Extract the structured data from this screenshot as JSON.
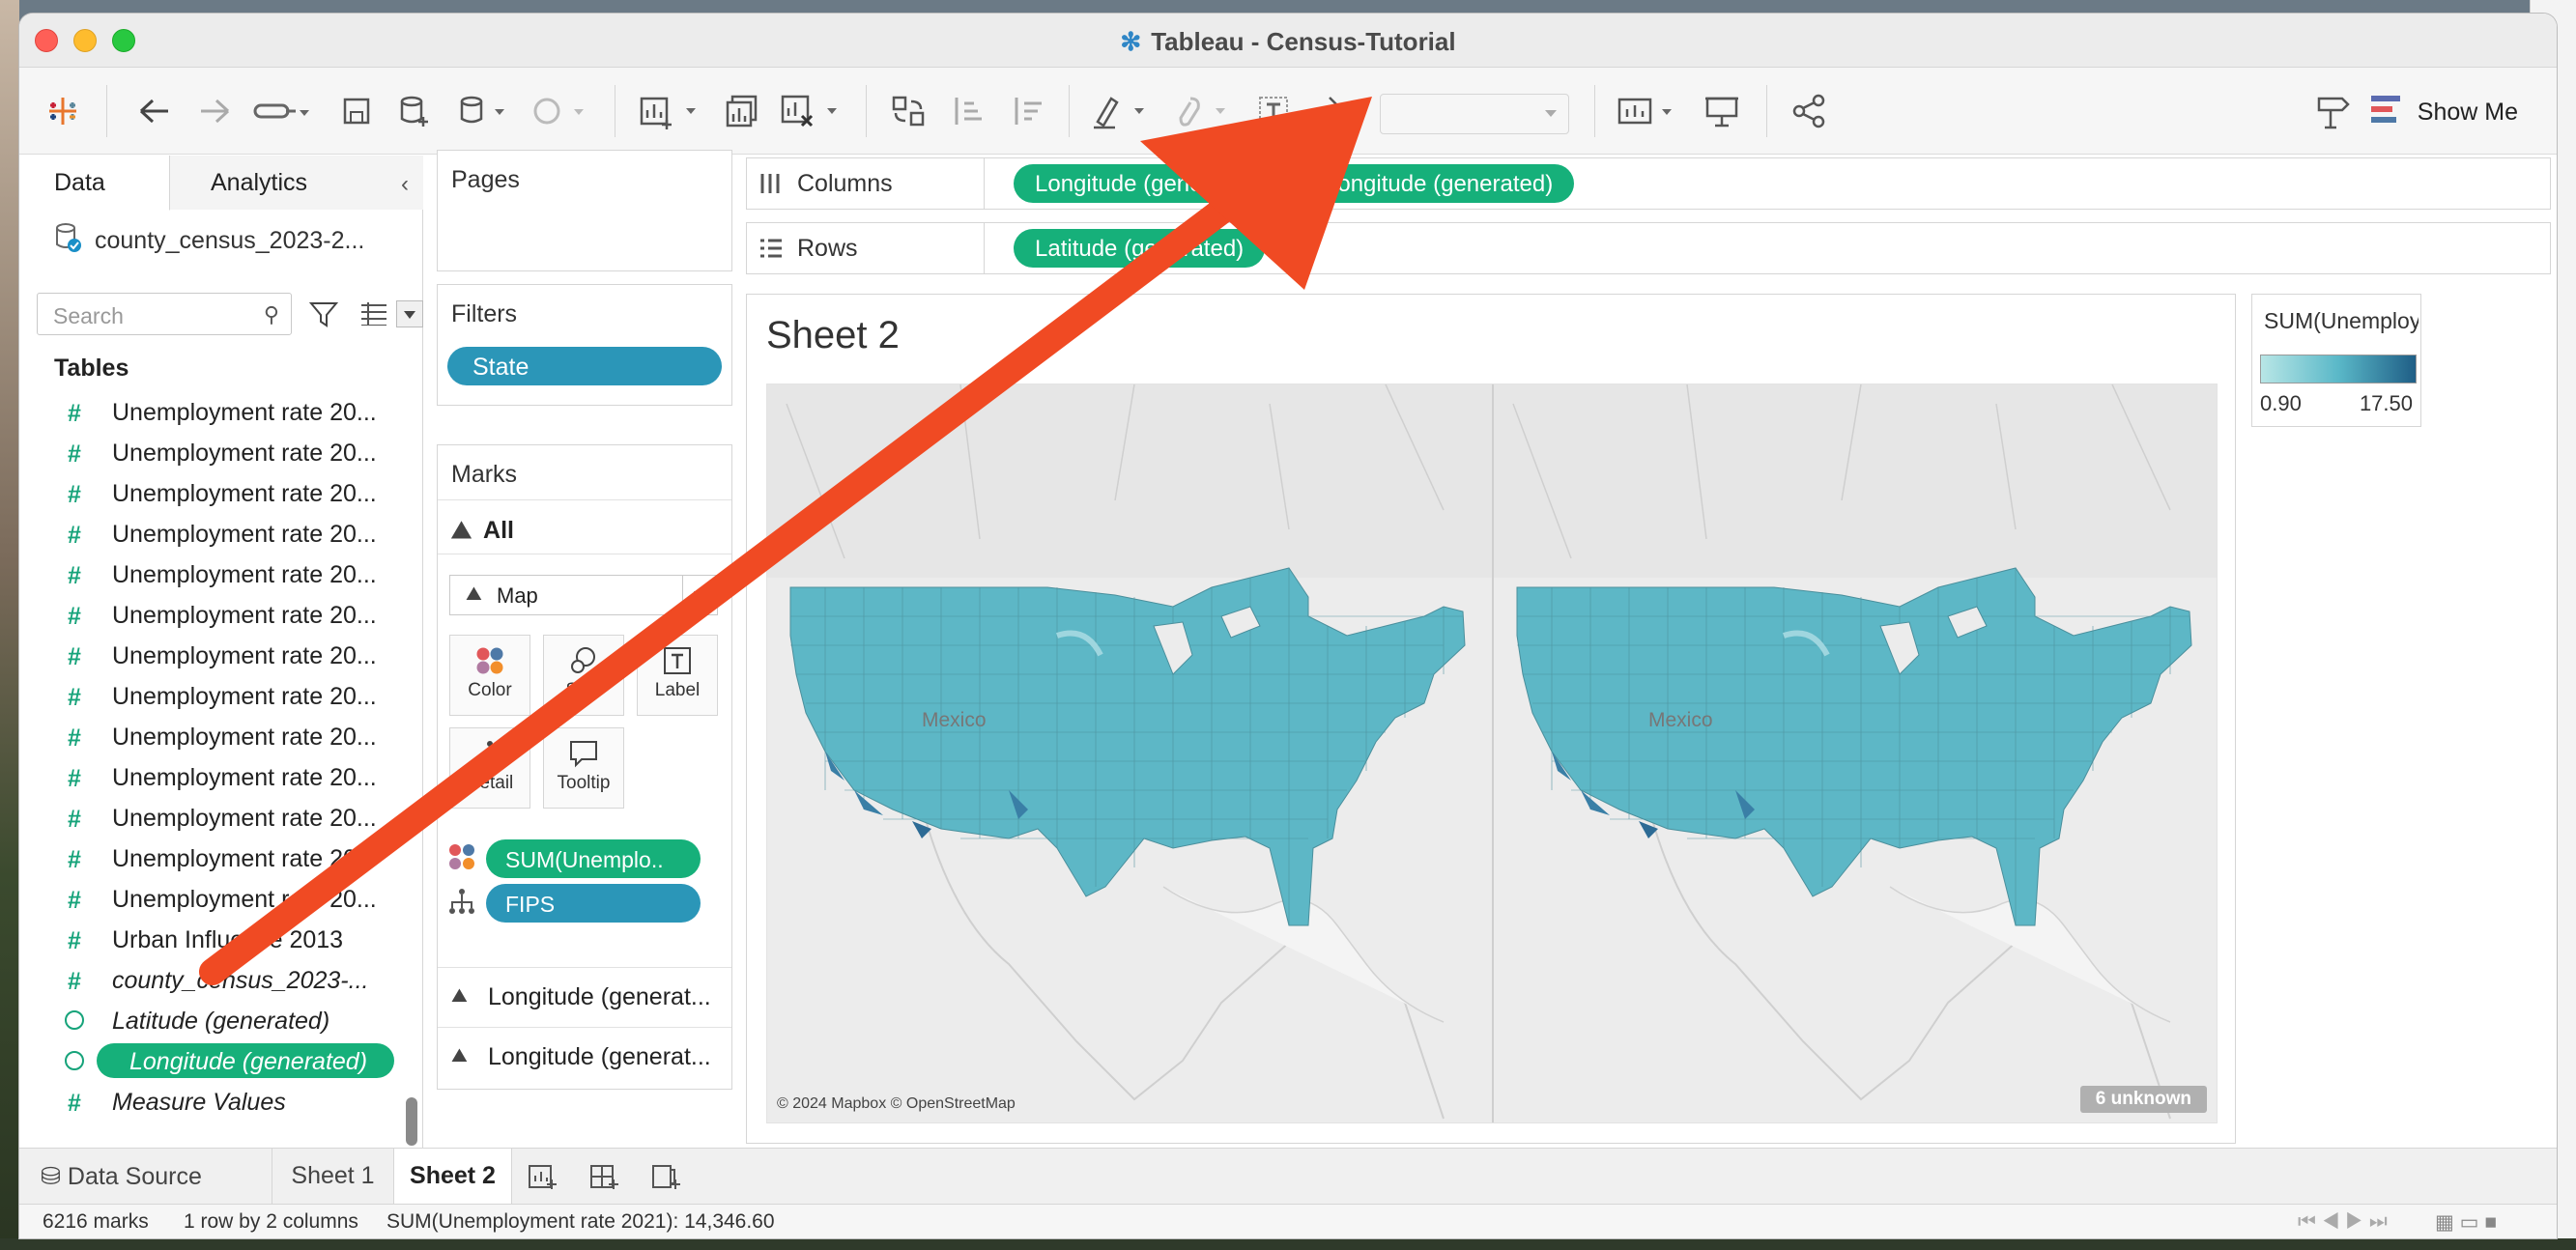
{
  "window": {
    "title": "Tableau - Census-Tutorial"
  },
  "toolbar": {
    "show_me_label": "Show Me"
  },
  "data_pane": {
    "tab_data": "Data",
    "tab_analytics": "Analytics",
    "data_source": "county_census_2023-2...",
    "search_placeholder": "Search",
    "tables_header": "Tables",
    "fields": [
      {
        "label": "Unemployment rate 20...",
        "type": "measure"
      },
      {
        "label": "Unemployment rate 20...",
        "type": "measure"
      },
      {
        "label": "Unemployment rate 20...",
        "type": "measure"
      },
      {
        "label": "Unemployment rate 20...",
        "type": "measure"
      },
      {
        "label": "Unemployment rate 20...",
        "type": "measure"
      },
      {
        "label": "Unemployment rate 20...",
        "type": "measure"
      },
      {
        "label": "Unemployment rate 20...",
        "type": "measure"
      },
      {
        "label": "Unemployment rate 20...",
        "type": "measure"
      },
      {
        "label": "Unemployment rate 20...",
        "type": "measure"
      },
      {
        "label": "Unemployment rate 20...",
        "type": "measure"
      },
      {
        "label": "Unemployment rate 20...",
        "type": "measure"
      },
      {
        "label": "Unemployment rate 20...",
        "type": "measure"
      },
      {
        "label": "Unemployment rate 20...",
        "type": "measure"
      },
      {
        "label": "Urban Influence 2013",
        "type": "measure"
      },
      {
        "label": "county_census_2023-...",
        "type": "measure"
      },
      {
        "label": "Latitude (generated)",
        "type": "geo"
      },
      {
        "label": "Longitude (generated)",
        "type": "geo"
      },
      {
        "label": "Measure Values",
        "type": "measure"
      }
    ]
  },
  "cards": {
    "pages_title": "Pages",
    "filters_title": "Filters",
    "filter_pill": "State",
    "marks_title": "Marks",
    "marks_all": "All",
    "mark_type": "Map",
    "buttons": {
      "color": "Color",
      "size": "Size",
      "label": "Label",
      "detail": "Detail",
      "tooltip": "Tooltip"
    },
    "color_pill": "SUM(Unemplo..",
    "detail_pill": "FIPS",
    "longitude_row_1": "Longitude (generat...",
    "longitude_row_2": "Longitude (generat..."
  },
  "shelves": {
    "columns_label": "Columns",
    "rows_label": "Rows",
    "columns_pill_1": "Longitude (generated)",
    "columns_pill_2": "Longitude (generated)",
    "rows_pill_1": "Latitude (generated)"
  },
  "view": {
    "sheet_title": "Sheet 2",
    "mexico_label_1": "Mexico",
    "mexico_label_2": "Mexico",
    "credit": "© 2024 Mapbox © OpenStreetMap",
    "unknown_badge": "6 unknown"
  },
  "legend": {
    "title": "SUM(Unemployment r...",
    "min": "0.90",
    "max": "17.50",
    "color_low": "#b8e6e6",
    "color_mid": "#5ab8c8",
    "color_high": "#1f5e86"
  },
  "sheet_tabs": {
    "data_source": "Data Source",
    "sheet1": "Sheet 1",
    "sheet2": "Sheet 2"
  },
  "status": {
    "marks": "6216 marks",
    "dimensions": "1 row by 2 columns",
    "sum": "SUM(Unemployment rate 2021): 14,346.60"
  },
  "colors": {
    "pill_green": "#16b07a",
    "pill_blue": "#2b96b8",
    "arrow": "#f04a23"
  }
}
